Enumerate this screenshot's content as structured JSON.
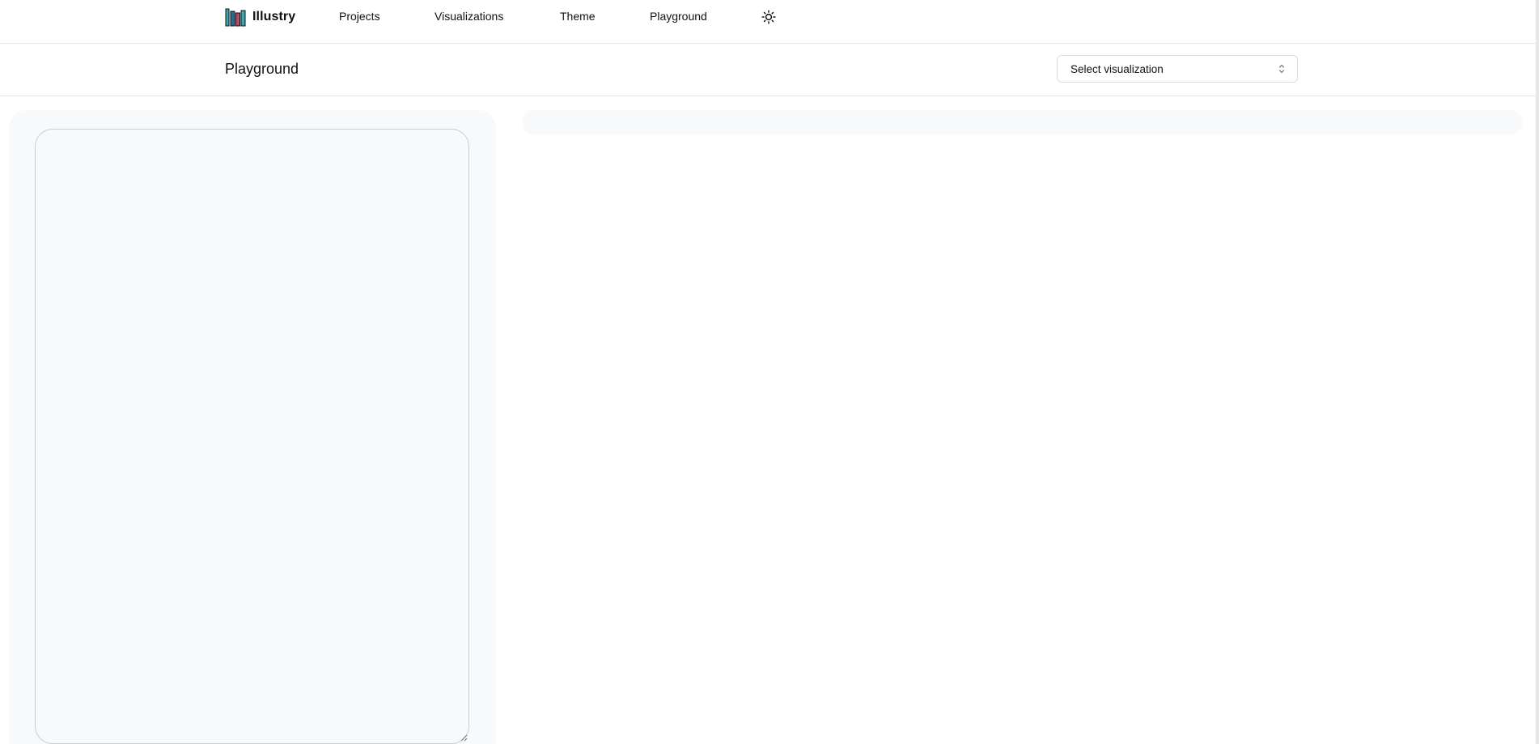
{
  "brand": {
    "name": "Illustry",
    "logo_colors": [
      "#1f2d3d",
      "#3aa7b3",
      "#b0506a",
      "#2c6a8f"
    ]
  },
  "nav": {
    "items": [
      {
        "label": "Projects"
      },
      {
        "label": "Visualizations"
      },
      {
        "label": "Theme"
      },
      {
        "label": "Playground"
      }
    ],
    "theme_toggle_icon": "sun-icon"
  },
  "header": {
    "title": "Playground",
    "select": {
      "selected": "Select visualization",
      "icon": "chevron-up-down-icon"
    }
  },
  "editor": {
    "value": ""
  },
  "colors": {
    "panel_bg": "#f8f9fa",
    "border": "#e5e7eb"
  }
}
